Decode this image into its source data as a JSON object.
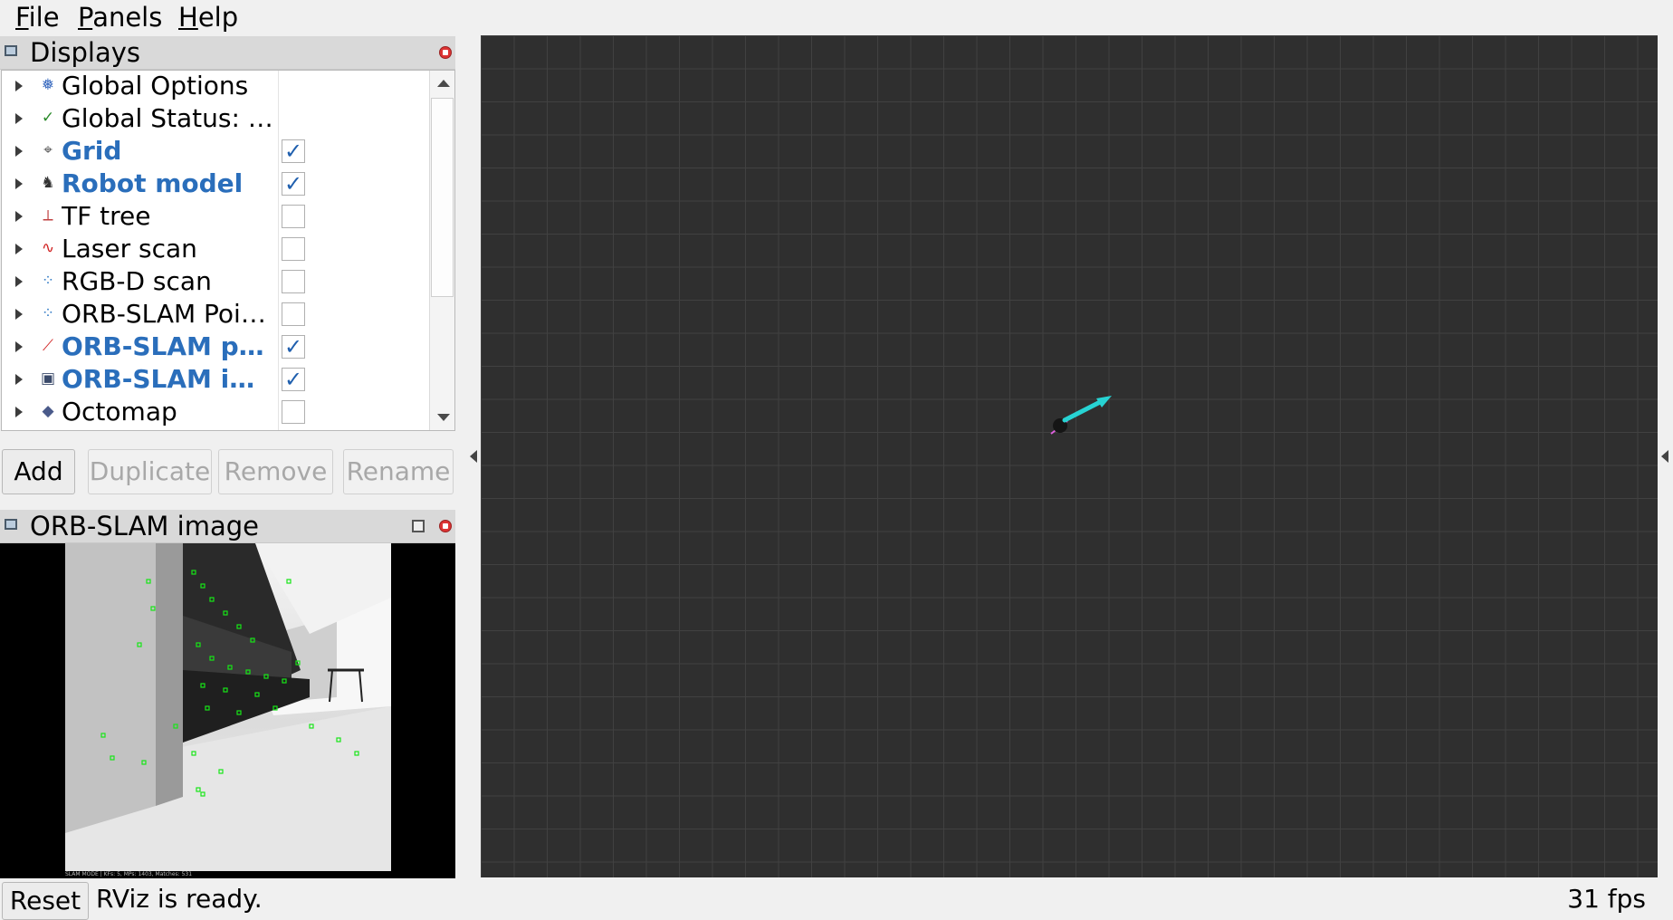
{
  "menu": [
    {
      "label": "File",
      "accel": "F",
      "rest": "ile"
    },
    {
      "label": "Panels",
      "accel": "P",
      "rest": "anels"
    },
    {
      "label": "Help",
      "accel": "H",
      "rest": "elp"
    }
  ],
  "displays_panel": {
    "title": "Displays",
    "items": [
      {
        "label": "Global Options",
        "icon": "gear-icon",
        "glyph": "❅",
        "color": "#3b6cc0",
        "enabled": null
      },
      {
        "label": "Global Status: Ok",
        "icon": "check-status-icon",
        "glyph": "✓",
        "color": "#2a8a2a",
        "enabled": null
      },
      {
        "label": "Grid",
        "icon": "grid-icon",
        "glyph": "⌖",
        "color": "#555555",
        "enabled": true
      },
      {
        "label": "Robot model",
        "icon": "robot-model-icon",
        "glyph": "♞",
        "color": "#333333",
        "enabled": true
      },
      {
        "label": "TF tree",
        "icon": "tf-axes-icon",
        "glyph": "⟂",
        "color": "#c04040",
        "enabled": false
      },
      {
        "label": "Laser scan",
        "icon": "laser-scan-icon",
        "glyph": "∿",
        "color": "#d02020",
        "enabled": false
      },
      {
        "label": "RGB-D scan",
        "icon": "point-cloud-icon",
        "glyph": "⁘",
        "color": "#3a80c8",
        "enabled": false
      },
      {
        "label": "ORB-SLAM Poin…",
        "icon": "point-cloud-icon",
        "glyph": "⁘",
        "color": "#3a80c8",
        "enabled": false
      },
      {
        "label": "ORB-SLAM pose",
        "icon": "pose-arrow-icon",
        "glyph": "⟋",
        "color": "#d02020",
        "enabled": true
      },
      {
        "label": "ORB-SLAM im…",
        "icon": "image-icon",
        "glyph": "▣",
        "color": "#3a4a6a",
        "enabled": true
      },
      {
        "label": "Octomap",
        "icon": "octomap-icon",
        "glyph": "◆",
        "color": "#4a5a8a",
        "enabled": false
      }
    ],
    "check_mark": "✓"
  },
  "buttons": {
    "add": "Add",
    "duplicate": "Duplicate",
    "remove": "Remove",
    "rename": "Rename"
  },
  "image_panel": {
    "title": "ORB-SLAM image",
    "status_strip": "SLAM MODE |  KFs: 5, MPs: 1403, Matches: 531"
  },
  "viewport": {
    "background": "#2f2f2f",
    "grid_color": "#414141",
    "arrow_color": "#27d3d3"
  },
  "statusbar": {
    "reset_label": "Reset",
    "message": "RViz is ready.",
    "fps": "31 fps"
  }
}
